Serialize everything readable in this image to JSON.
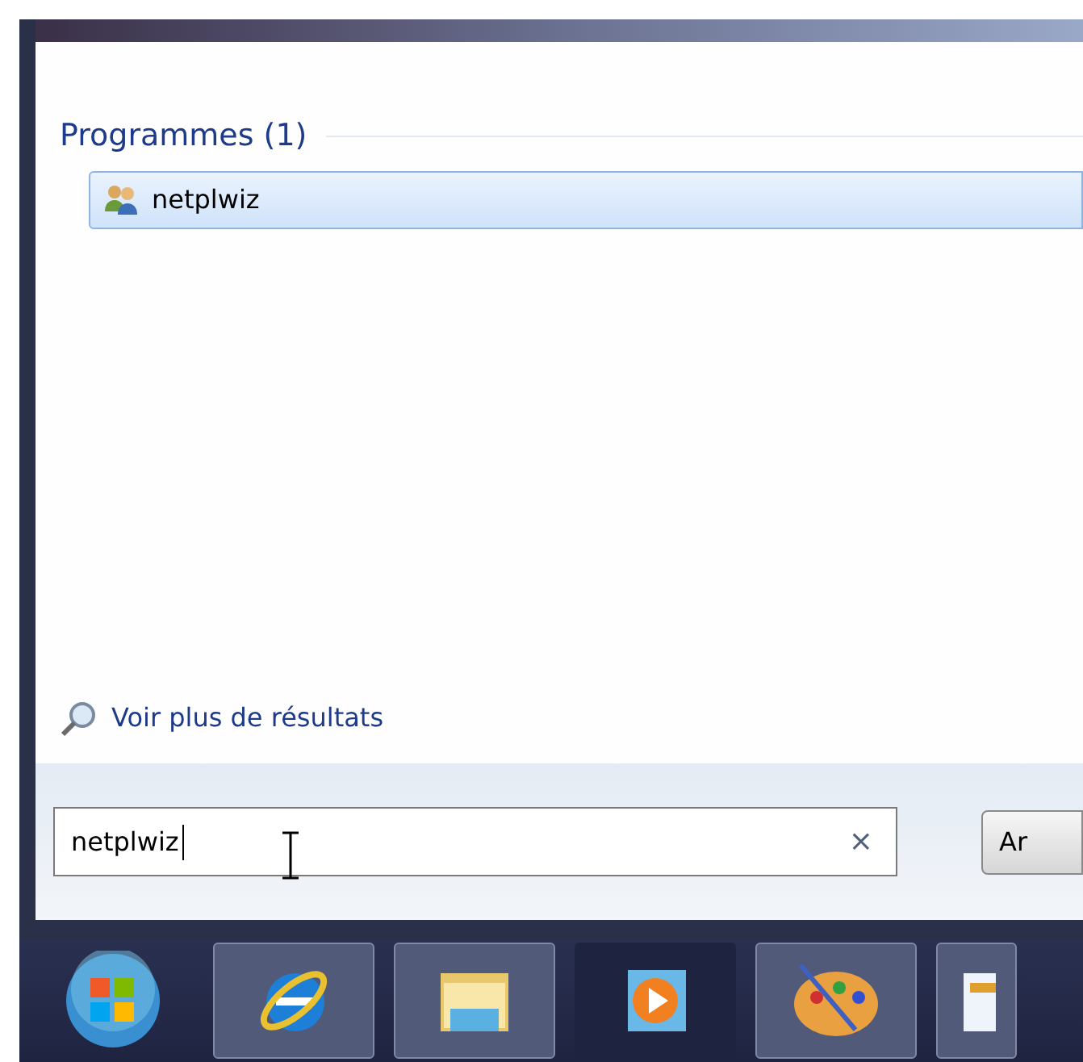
{
  "results": {
    "heading": "Programmes (1)",
    "items": [
      {
        "label": "netplwiz",
        "selected": true
      }
    ]
  },
  "more_results": "Voir plus de résultats",
  "search": {
    "value": "netplwiz",
    "clear": "×"
  },
  "side_button": "Ar",
  "taskbar": [
    {
      "kind": "browser",
      "running": true
    },
    {
      "kind": "folder",
      "running": true
    },
    {
      "kind": "media",
      "running": false
    },
    {
      "kind": "paint",
      "running": true
    },
    {
      "kind": "document",
      "running": true
    }
  ]
}
